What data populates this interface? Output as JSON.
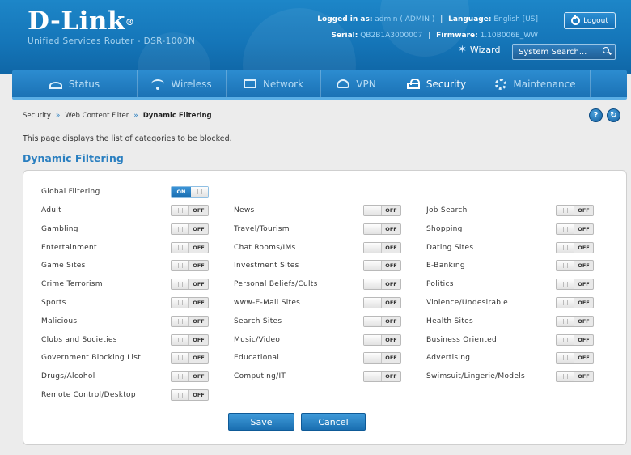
{
  "brand": {
    "logo": "D-Link",
    "logo_mark": "®",
    "subtitle": "Unified Services Router - DSR-1000N"
  },
  "header": {
    "logged_in_label": "Logged in as:",
    "logged_in_value": "admin ( ADMIN )",
    "language_label": "Language:",
    "language_value": "English [US]",
    "serial_label": "Serial:",
    "serial_value": "QB2B1A3000007",
    "firmware_label": "Firmware:",
    "firmware_value": "1.10B006E_WW",
    "logout_label": "Logout",
    "wizard_label": "Wizard",
    "search_placeholder": "System Search..."
  },
  "nav": {
    "status": "Status",
    "wireless": "Wireless",
    "network": "Network",
    "vpn": "VPN",
    "security": "Security",
    "maintenance": "Maintenance"
  },
  "breadcrumb": {
    "item1": "Security",
    "item2": "Web Content Filter",
    "item3": "Dynamic Filtering",
    "sep": "»"
  },
  "help_label": "?",
  "description": "This page displays the list of categories to be blocked.",
  "section_title": "Dynamic Filtering",
  "global": {
    "label": "Global Filtering",
    "state": "ON"
  },
  "toggle_off_text": "OFF",
  "categories": {
    "col1": [
      "Adult",
      "Gambling",
      "Entertainment",
      "Game Sites",
      "Crime Terrorism",
      "Sports",
      "Malicious",
      "Clubs and Societies",
      "Government Blocking List",
      "Drugs/Alcohol",
      "Remote Control/Desktop"
    ],
    "col2": [
      "News",
      "Travel/Tourism",
      "Chat Rooms/IMs",
      "Investment Sites",
      "Personal Beliefs/Cults",
      "www-E-Mail Sites",
      "Search Sites",
      "Music/Video",
      "Educational",
      "Computing/IT"
    ],
    "col3": [
      "Job Search",
      "Shopping",
      "Dating Sites",
      "E-Banking",
      "Politics",
      "Violence/Undesirable",
      "Health Sites",
      "Business Oriented",
      "Advertising",
      "Swimsuit/Lingerie/Models"
    ]
  },
  "buttons": {
    "save": "Save",
    "cancel": "Cancel"
  }
}
